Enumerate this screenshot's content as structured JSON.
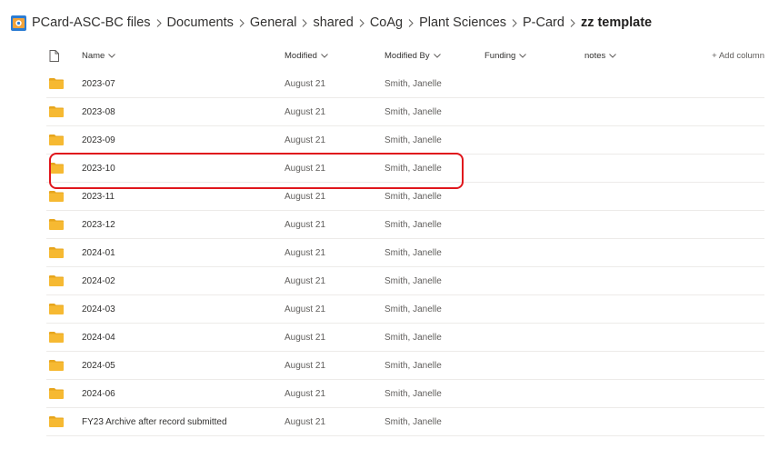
{
  "breadcrumb": {
    "site_icon": "sharepoint-site-icon",
    "items": [
      "PCard-ASC-BC files",
      "Documents",
      "General",
      "shared",
      "CoAg",
      "Plant Sciences",
      "P-Card",
      "zz template"
    ]
  },
  "columns": {
    "type_icon": "file-type-icon",
    "name": "Name",
    "modified": "Modified",
    "modified_by": "Modified By",
    "funding": "Funding",
    "notes": "notes",
    "add_column": "+ Add column"
  },
  "rows": [
    {
      "name": "2023-07",
      "modified": "August 21",
      "modified_by": "Smith, Janelle"
    },
    {
      "name": "2023-08",
      "modified": "August 21",
      "modified_by": "Smith, Janelle"
    },
    {
      "name": "2023-09",
      "modified": "August 21",
      "modified_by": "Smith, Janelle"
    },
    {
      "name": "2023-10",
      "modified": "August 21",
      "modified_by": "Smith, Janelle"
    },
    {
      "name": "2023-11",
      "modified": "August 21",
      "modified_by": "Smith, Janelle"
    },
    {
      "name": "2023-12",
      "modified": "August 21",
      "modified_by": "Smith, Janelle"
    },
    {
      "name": "2024-01",
      "modified": "August 21",
      "modified_by": "Smith, Janelle"
    },
    {
      "name": "2024-02",
      "modified": "August 21",
      "modified_by": "Smith, Janelle"
    },
    {
      "name": "2024-03",
      "modified": "August 21",
      "modified_by": "Smith, Janelle"
    },
    {
      "name": "2024-04",
      "modified": "August 21",
      "modified_by": "Smith, Janelle"
    },
    {
      "name": "2024-05",
      "modified": "August 21",
      "modified_by": "Smith, Janelle"
    },
    {
      "name": "2024-06",
      "modified": "August 21",
      "modified_by": "Smith, Janelle"
    },
    {
      "name": "FY23 Archive after record submitted",
      "modified": "August 21",
      "modified_by": "Smith, Janelle"
    }
  ],
  "colors": {
    "folder": "#f6b932",
    "folder_tab": "#e7a51c",
    "highlight": "#e0161c",
    "text": "#323130",
    "muted": "#605e5c"
  }
}
